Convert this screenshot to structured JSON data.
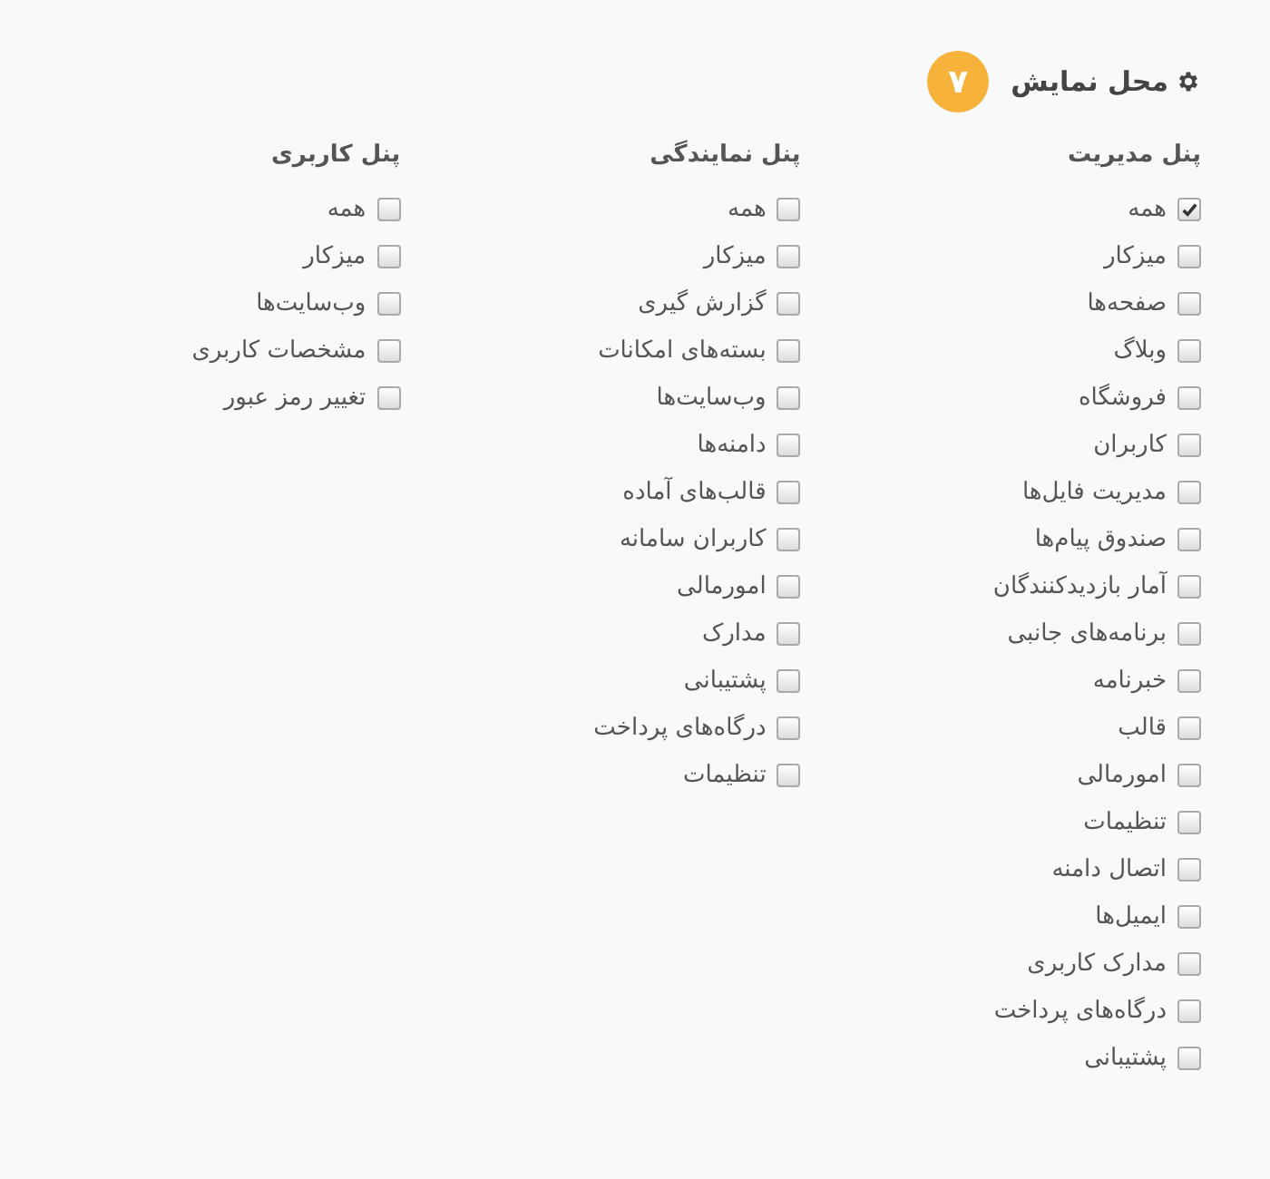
{
  "section": {
    "title": "محل نمایش",
    "badge": "۷"
  },
  "panels": [
    {
      "title": "پنل مدیریت",
      "items": [
        {
          "label": "همه",
          "checked": true
        },
        {
          "label": "میزکار",
          "checked": false
        },
        {
          "label": "صفحه‌ها",
          "checked": false
        },
        {
          "label": "وبلاگ",
          "checked": false
        },
        {
          "label": "فروشگاه",
          "checked": false
        },
        {
          "label": "کاربران",
          "checked": false
        },
        {
          "label": "مدیریت فایل‌ها",
          "checked": false
        },
        {
          "label": "صندوق پیام‌ها",
          "checked": false
        },
        {
          "label": "آمار بازدیدکنندگان",
          "checked": false
        },
        {
          "label": "برنامه‌های جانبی",
          "checked": false
        },
        {
          "label": "خبرنامه",
          "checked": false
        },
        {
          "label": "قالب",
          "checked": false
        },
        {
          "label": "امورمالی",
          "checked": false
        },
        {
          "label": "تنظیمات",
          "checked": false
        },
        {
          "label": "اتصال دامنه",
          "checked": false
        },
        {
          "label": "ایمیل‌ها",
          "checked": false
        },
        {
          "label": "مدارک کاربری",
          "checked": false
        },
        {
          "label": "درگاه‌های پرداخت",
          "checked": false
        },
        {
          "label": "پشتیبانی",
          "checked": false
        }
      ]
    },
    {
      "title": "پنل نمایندگی",
      "items": [
        {
          "label": "همه",
          "checked": false
        },
        {
          "label": "میزکار",
          "checked": false
        },
        {
          "label": "گزارش گیری",
          "checked": false
        },
        {
          "label": "بسته‌های امکانات",
          "checked": false
        },
        {
          "label": "وب‌سایت‌ها",
          "checked": false
        },
        {
          "label": "دامنه‌ها",
          "checked": false
        },
        {
          "label": "قالب‌های آماده",
          "checked": false
        },
        {
          "label": "کاربران سامانه",
          "checked": false
        },
        {
          "label": "امورمالی",
          "checked": false
        },
        {
          "label": "مدارک",
          "checked": false
        },
        {
          "label": "پشتیبانی",
          "checked": false
        },
        {
          "label": "درگاه‌های پرداخت",
          "checked": false
        },
        {
          "label": "تنظیمات",
          "checked": false
        }
      ]
    },
    {
      "title": "پنل کاربری",
      "items": [
        {
          "label": "همه",
          "checked": false
        },
        {
          "label": "میزکار",
          "checked": false
        },
        {
          "label": "وب‌سایت‌ها",
          "checked": false
        },
        {
          "label": "مشخصات کاربری",
          "checked": false
        },
        {
          "label": "تغییر رمز عبور",
          "checked": false
        }
      ]
    }
  ]
}
